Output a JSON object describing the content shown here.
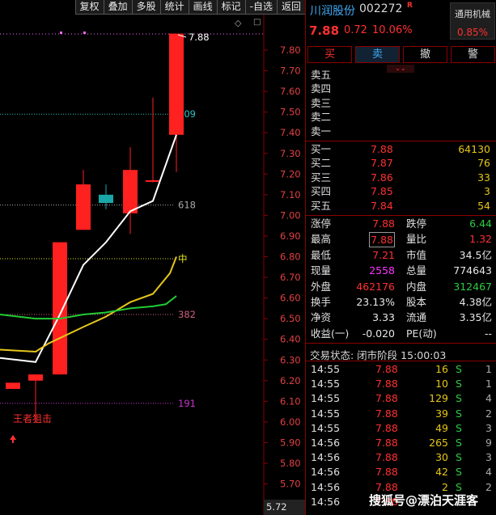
{
  "toolbar": [
    "复权",
    "叠加",
    "多股",
    "统计",
    "画线",
    "标记",
    "-自选",
    "返回"
  ],
  "chart_data": {
    "type": "candlestick",
    "y_ticks": [
      "7.80",
      "7.70",
      "7.60",
      "7.50",
      "7.40",
      "7.30",
      "7.20",
      "7.10",
      "7.00",
      "6.90",
      "6.80",
      "6.70",
      "6.60",
      "6.50",
      "6.40",
      "6.30",
      "6.20",
      "6.10",
      "6.00",
      "5.90",
      "5.80",
      "5.70"
    ],
    "ylim": [
      5.72,
      7.92
    ],
    "candles": [
      {
        "o": 6.16,
        "c": 6.19,
        "h": 6.19,
        "l": 6.16,
        "color": "red"
      },
      {
        "o": 6.2,
        "c": 6.23,
        "h": 6.23,
        "l": 6.0,
        "color": "red"
      },
      {
        "o": 6.23,
        "c": 6.87,
        "h": 6.87,
        "l": 6.23,
        "color": "red"
      },
      {
        "o": 6.93,
        "c": 7.15,
        "h": 7.22,
        "l": 6.93,
        "color": "red"
      },
      {
        "o": 7.06,
        "c": 7.1,
        "h": 7.15,
        "l": 7.03,
        "color": "cyan"
      },
      {
        "o": 7.01,
        "c": 7.22,
        "h": 7.33,
        "l": 6.91,
        "color": "red"
      },
      {
        "o": 7.17,
        "c": 7.17,
        "h": 7.57,
        "l": 7.16,
        "color": "red"
      },
      {
        "o": 7.39,
        "c": 7.88,
        "h": 7.88,
        "l": 7.21,
        "color": "red"
      }
    ],
    "ma_white": [
      6.31,
      6.29,
      6.52,
      6.76,
      6.87,
      7.02,
      7.07,
      7.39
    ],
    "ma_yellow": [
      6.35,
      6.34,
      6.38,
      6.46,
      6.51,
      6.58,
      6.62,
      6.72,
      6.8
    ],
    "ma_green": [
      6.52,
      6.5,
      6.5,
      6.52,
      6.53,
      6.55,
      6.56,
      6.57,
      6.61
    ],
    "levels": [
      {
        "label": "809",
        "value": 7.49,
        "color": "#2ec4c4"
      },
      {
        "label": "618",
        "value": 7.05,
        "color": "#aaaaaa"
      },
      {
        "label": "中",
        "value": 6.79,
        "color": "#e6e619"
      },
      {
        "label": "382",
        "value": 6.52,
        "color": "#d06080"
      },
      {
        "label": "191",
        "value": 6.09,
        "color": "#cc33cc"
      }
    ],
    "top_label": "7.88",
    "bottom_label": "5.72",
    "annotation": "王者狙击"
  },
  "stock": {
    "name": "川润股份",
    "code": "002272",
    "mark": "R",
    "price": "7.88",
    "change": "0.72",
    "pct": "10.06%",
    "sector": "通用机械",
    "sector_pct": "0.85%"
  },
  "actions": [
    "买",
    "卖",
    "撤",
    "警"
  ],
  "dropdown_icon": "double-chevron-down-icon",
  "asks": [
    {
      "label": "卖五",
      "price": "",
      "vol": ""
    },
    {
      "label": "卖四",
      "price": "",
      "vol": ""
    },
    {
      "label": "卖三",
      "price": "",
      "vol": ""
    },
    {
      "label": "卖二",
      "price": "",
      "vol": ""
    },
    {
      "label": "卖一",
      "price": "",
      "vol": ""
    }
  ],
  "bids": [
    {
      "label": "买一",
      "price": "7.88",
      "vol": "64130"
    },
    {
      "label": "买二",
      "price": "7.87",
      "vol": "76"
    },
    {
      "label": "买三",
      "price": "7.86",
      "vol": "33"
    },
    {
      "label": "买四",
      "price": "7.85",
      "vol": "3"
    },
    {
      "label": "买五",
      "price": "7.84",
      "vol": "54"
    }
  ],
  "stats": [
    {
      "l1": "涨停",
      "v1": "7.88",
      "c1": "red",
      "l2": "跌停",
      "v2": "6.44",
      "c2": "green"
    },
    {
      "l1": "最高",
      "v1": "7.88",
      "c1": "red",
      "l2": "量比",
      "v2": "1.32",
      "c2": "red"
    },
    {
      "l1": "最低",
      "v1": "7.21",
      "c1": "red",
      "l2": "市值",
      "v2": "34.5亿",
      "c2": "white"
    },
    {
      "l1": "现量",
      "v1": "2558",
      "c1": "magenta",
      "l2": "总量",
      "v2": "774643",
      "c2": "white"
    },
    {
      "l1": "外盘",
      "v1": "462176",
      "c1": "red",
      "l2": "内盘",
      "v2": "312467",
      "c2": "green"
    },
    {
      "l1": "换手",
      "v1": "23.13%",
      "c1": "white",
      "l2": "股本",
      "v2": "4.38亿",
      "c2": "white"
    },
    {
      "l1": "净资",
      "v1": "3.33",
      "c1": "white",
      "l2": "流通",
      "v2": "3.35亿",
      "c2": "white"
    },
    {
      "l1": "收益(一)",
      "v1": "-0.020",
      "c1": "white",
      "l2": "PE(动)",
      "v2": "--",
      "c2": "white"
    }
  ],
  "status": "交易状态: 闭市阶段 15:00:03",
  "ticks": [
    {
      "t": "14:55",
      "p": "7.88",
      "v": "16",
      "d": "S",
      "n": "1"
    },
    {
      "t": "14:55",
      "p": "7.88",
      "v": "10",
      "d": "S",
      "n": "1"
    },
    {
      "t": "14:55",
      "p": "7.88",
      "v": "129",
      "d": "S",
      "n": "4"
    },
    {
      "t": "14:55",
      "p": "7.88",
      "v": "39",
      "d": "S",
      "n": "2"
    },
    {
      "t": "14:55",
      "p": "7.88",
      "v": "49",
      "d": "S",
      "n": "3"
    },
    {
      "t": "14:56",
      "p": "7.88",
      "v": "265",
      "d": "S",
      "n": "9"
    },
    {
      "t": "14:56",
      "p": "7.88",
      "v": "30",
      "d": "S",
      "n": "3"
    },
    {
      "t": "14:56",
      "p": "7.88",
      "v": "42",
      "d": "S",
      "n": "4"
    },
    {
      "t": "14:56",
      "p": "7.88",
      "v": "2",
      "d": "S",
      "n": "2"
    },
    {
      "t": "14:56",
      "p": "7.88",
      "v": "",
      "d": "",
      "n": ""
    }
  ],
  "watermark": "搜狐号@漂泊天涯客"
}
